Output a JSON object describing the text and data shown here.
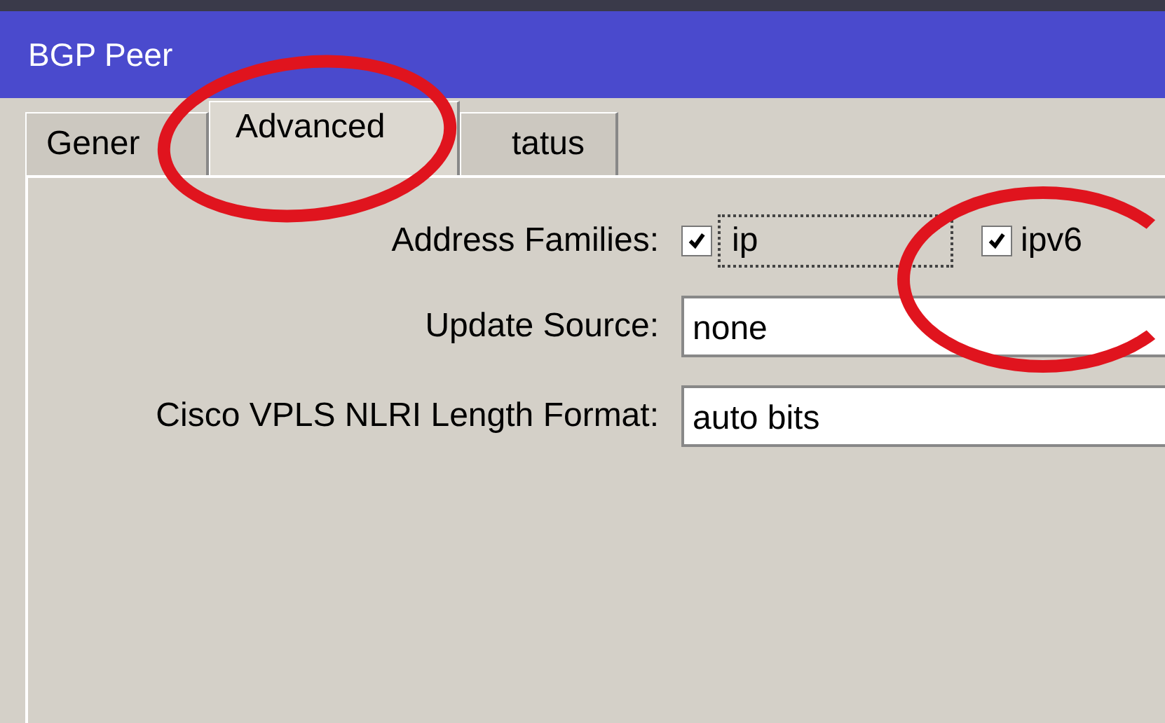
{
  "window": {
    "title": "BGP Peer"
  },
  "tabs": [
    {
      "label": "Gener",
      "selected": false
    },
    {
      "label": "Advanced",
      "selected": true
    },
    {
      "label": "tatus",
      "selected": false
    }
  ],
  "address_families": {
    "label": "Address Families:",
    "options": [
      {
        "label": "ip",
        "checked": true,
        "focused": true
      },
      {
        "label": "ipv6",
        "checked": true,
        "focused": false
      }
    ]
  },
  "fields": [
    {
      "label": "Update Source:",
      "value": "none"
    },
    {
      "label": "Cisco VPLS NLRI Length Format:",
      "value": "auto bits"
    }
  ],
  "annotations": [
    {
      "kind": "ellipse"
    },
    {
      "kind": "ellipse"
    }
  ]
}
